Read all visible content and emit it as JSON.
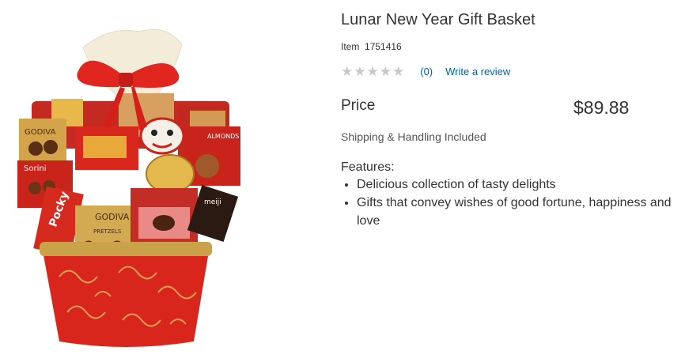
{
  "product": {
    "title": "Lunar New Year Gift Basket",
    "item_label": "Item",
    "item_number": "1751416",
    "rating": {
      "stars": 0,
      "max": 5,
      "count_text": "(0)",
      "write_review": "Write a review"
    },
    "price_label": "Price",
    "price": "$89.88",
    "shipping": "Shipping & Handling Included",
    "features_label": "Features:",
    "features": [
      "Delicious collection of tasty delights",
      "Gifts that convey wishes of good fortune, happiness and love"
    ]
  },
  "image": {
    "labels": {
      "godiva_1": "GODIVA",
      "godiva_2": "GODIVA",
      "sorini": "Sorini",
      "pocky": "Pocky",
      "almonds": "ALMONDS AMANDES",
      "meiji": "meiji",
      "pretzels": "PRETZELS"
    }
  },
  "colors": {
    "link": "#0060a9",
    "basket_red": "#d8261c",
    "ribbon_red": "#e0261e",
    "gold": "#c9a24a"
  }
}
